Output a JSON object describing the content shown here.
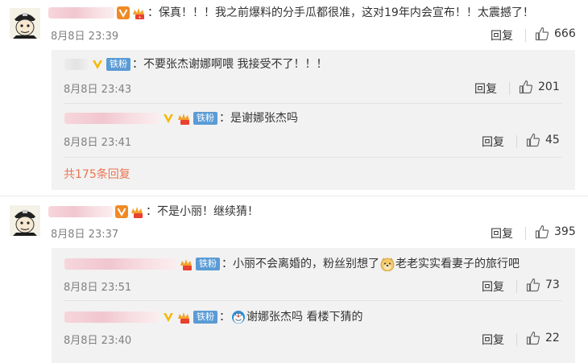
{
  "comments": [
    {
      "text": "：保真！！！我之前爆料的分手瓜都很准，这对19年内会宣布！！太震撼了！",
      "time": "8月8日 23:39",
      "reply_label": "回复",
      "likes": "666",
      "replies": [
        {
          "text": "：不要张杰谢娜啊喂 我接受不了！！！",
          "time": "8月8日 23:43",
          "reply_label": "回复",
          "likes": "201",
          "badge": "铁粉"
        },
        {
          "text": "：是谢娜张杰吗",
          "time": "8月8日 23:41",
          "reply_label": "回复",
          "likes": "45",
          "badge": "铁粉"
        }
      ],
      "more_label": "共175条回复"
    },
    {
      "text": "：不是小丽！继续猜！",
      "time": "8月8日 23:37",
      "reply_label": "回复",
      "likes": "395",
      "replies": [
        {
          "text_before": "：小丽不会离婚的，粉丝别想了",
          "text_after": "老老实实看妻子的旅行吧",
          "time": "8月8日 23:51",
          "reply_label": "回复",
          "likes": "73",
          "badge": "铁粉"
        },
        {
          "text": "谢娜张杰吗 看楼下猜的",
          "time": "8月8日 23:40",
          "reply_label": "回复",
          "likes": "22",
          "badge": "铁粉"
        }
      ]
    }
  ],
  "colors": {
    "accent": "#eb7350",
    "badge_blue": "#5a9bd5",
    "vip_orange": "#f08a24"
  }
}
